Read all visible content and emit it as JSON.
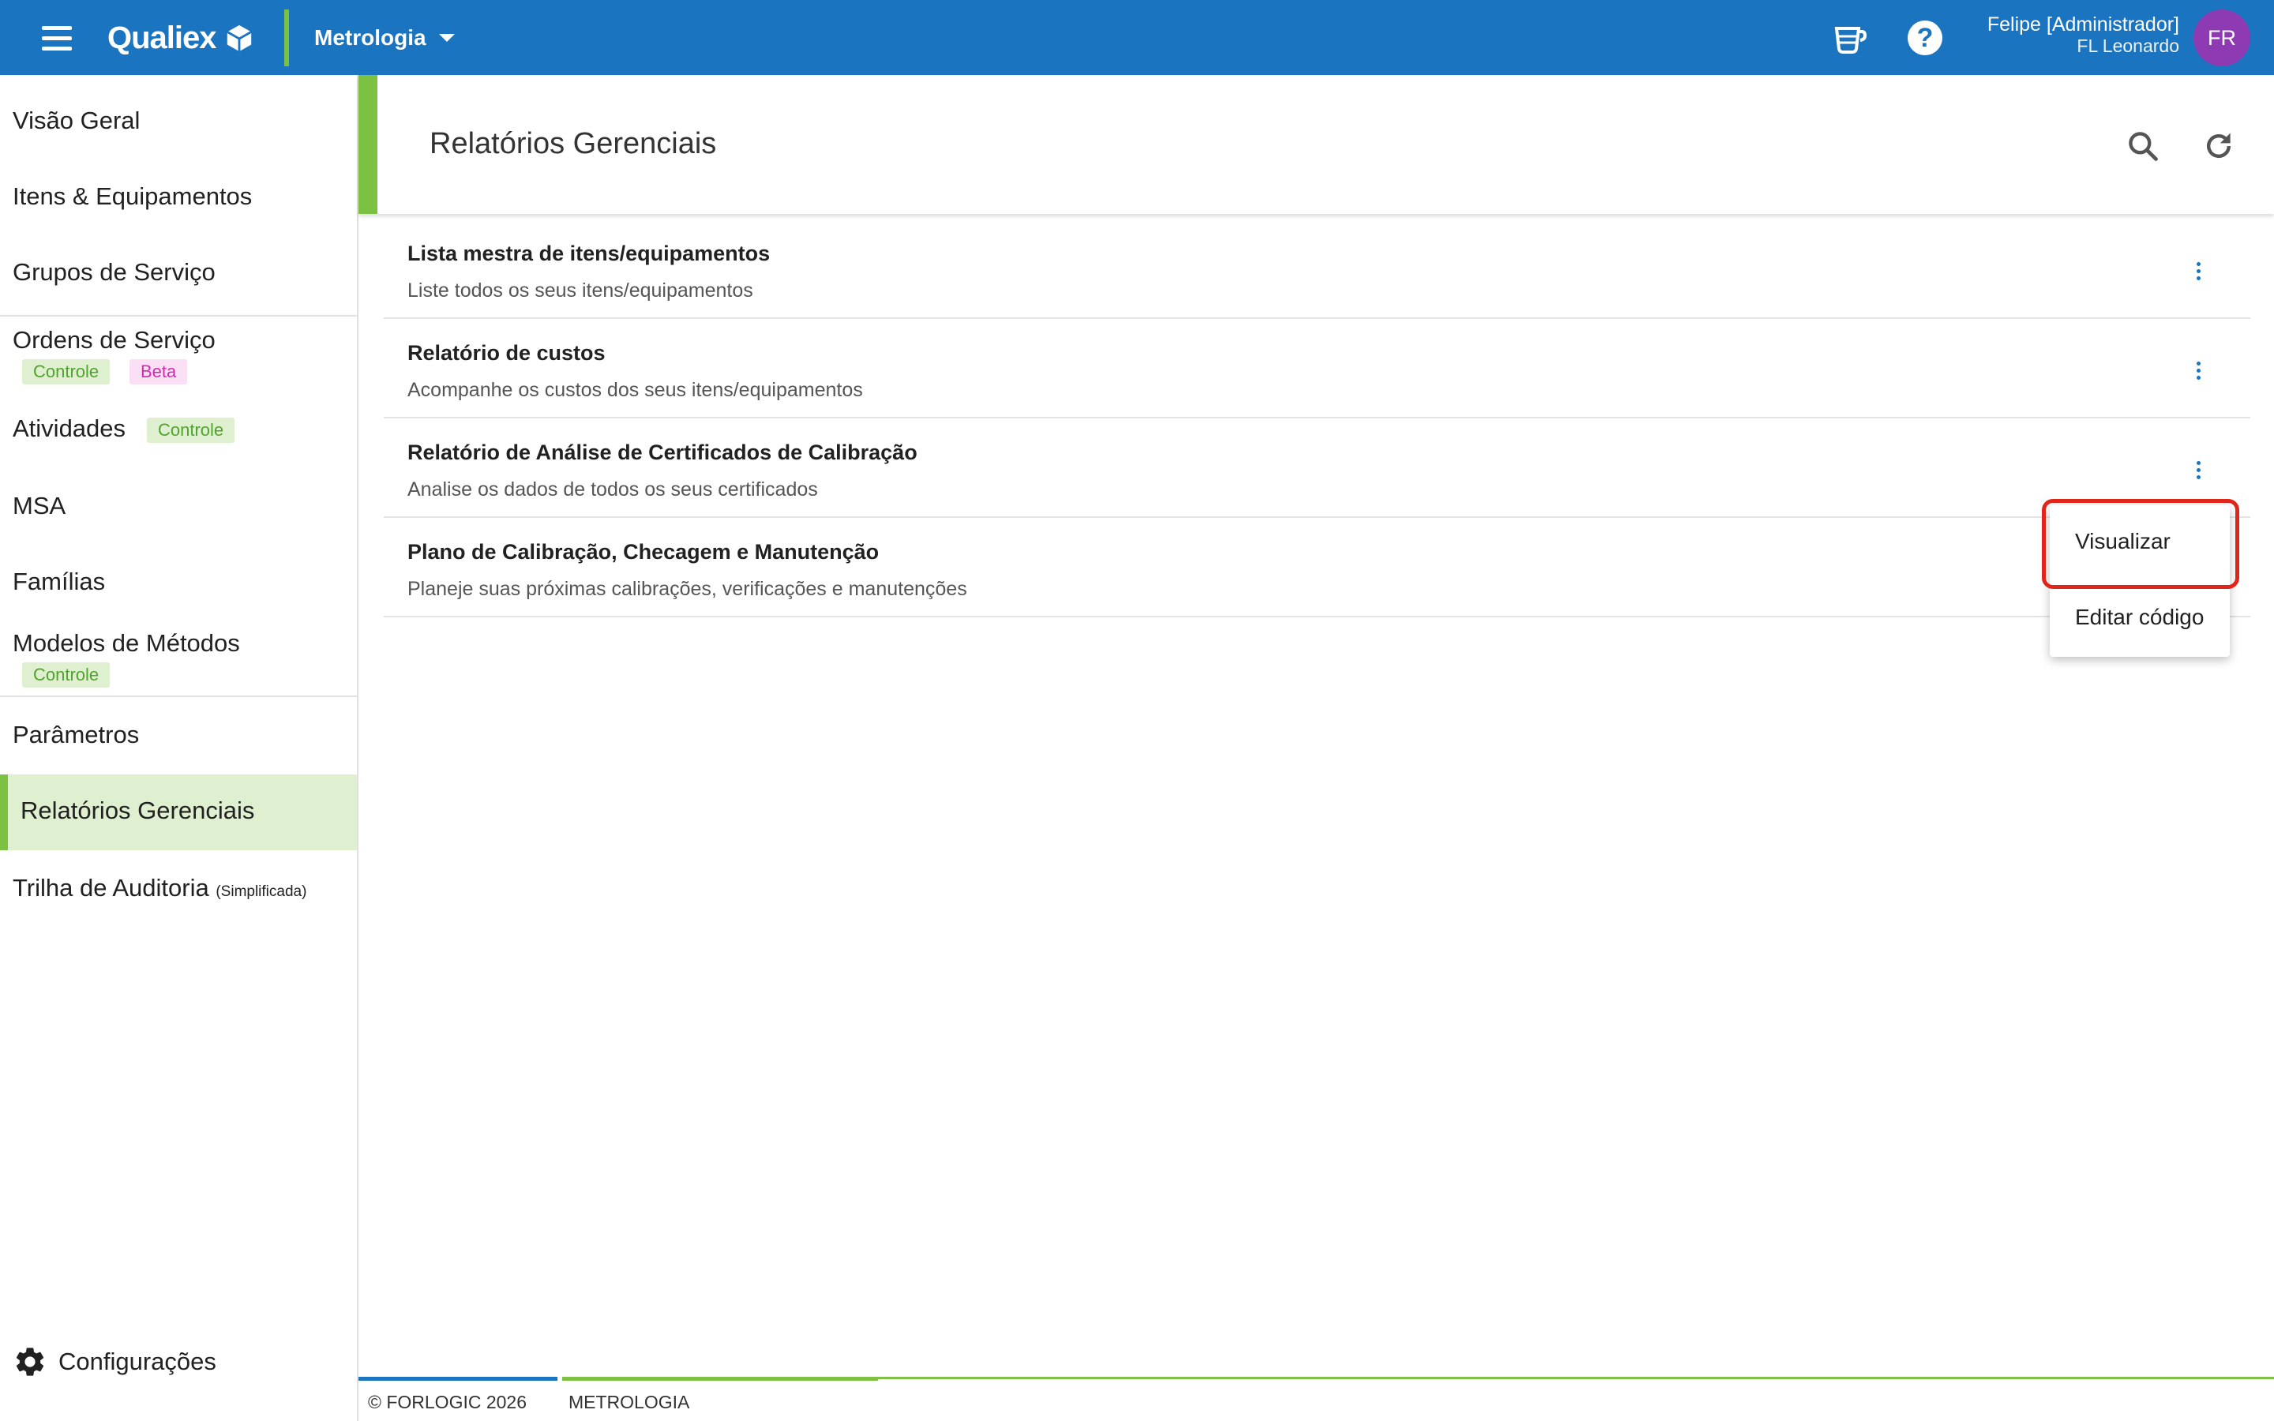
{
  "topbar": {
    "brand": "Qualiex",
    "module": "Metrologia",
    "user_name": "Felipe [Administrador]",
    "user_company": "FL Leonardo",
    "avatar_initials": "FR",
    "help_symbol": "?",
    "icons": [
      "menu-icon",
      "coffee-cup-icon",
      "help-icon"
    ]
  },
  "sidebar": {
    "items": [
      {
        "label": "Visão Geral"
      },
      {
        "label": "Itens & Equipamentos"
      },
      {
        "label": "Grupos de Serviço"
      },
      {
        "label": "Ordens de Serviço",
        "badges": [
          "Controle",
          "Beta"
        ]
      },
      {
        "label": "Atividades",
        "badges": [
          "Controle"
        ]
      },
      {
        "label": "MSA"
      },
      {
        "label": "Famílias"
      },
      {
        "label": "Modelos de Métodos",
        "badges": [
          "Controle"
        ]
      },
      {
        "label": "Parâmetros"
      },
      {
        "label": "Relatórios Gerenciais",
        "active": true
      },
      {
        "label": "Trilha de Auditoria",
        "note": "(Simplificada)"
      }
    ],
    "settings_label": "Configurações"
  },
  "main": {
    "title": "Relatórios Gerenciais",
    "reports": [
      {
        "title": "Lista mestra de itens/equipamentos",
        "description": "Liste todos os seus itens/equipamentos"
      },
      {
        "title": "Relatório de custos",
        "description": "Acompanhe os custos dos seus itens/equipamentos"
      },
      {
        "title": "Relatório de Análise de Certificados de Calibração",
        "description": "Analise os dados de todos os seus certificados"
      },
      {
        "title": "Plano de Calibração, Checagem e Manutenção",
        "description": "Planeje suas próximas calibrações, verificações e manutenções"
      }
    ]
  },
  "context_menu": {
    "items": [
      "Visualizar",
      "Editar código"
    ]
  },
  "footer": {
    "copyright": "© FORLOGIC 2026",
    "module": "METROLOGIA"
  },
  "colors": {
    "primary": "#1b74c0",
    "accent_green": "#7dc142",
    "badge_green_bg": "#dff0d0",
    "badge_pink_bg": "#fadff5",
    "avatar": "#8e3bb3",
    "highlight": "#e0251a"
  }
}
